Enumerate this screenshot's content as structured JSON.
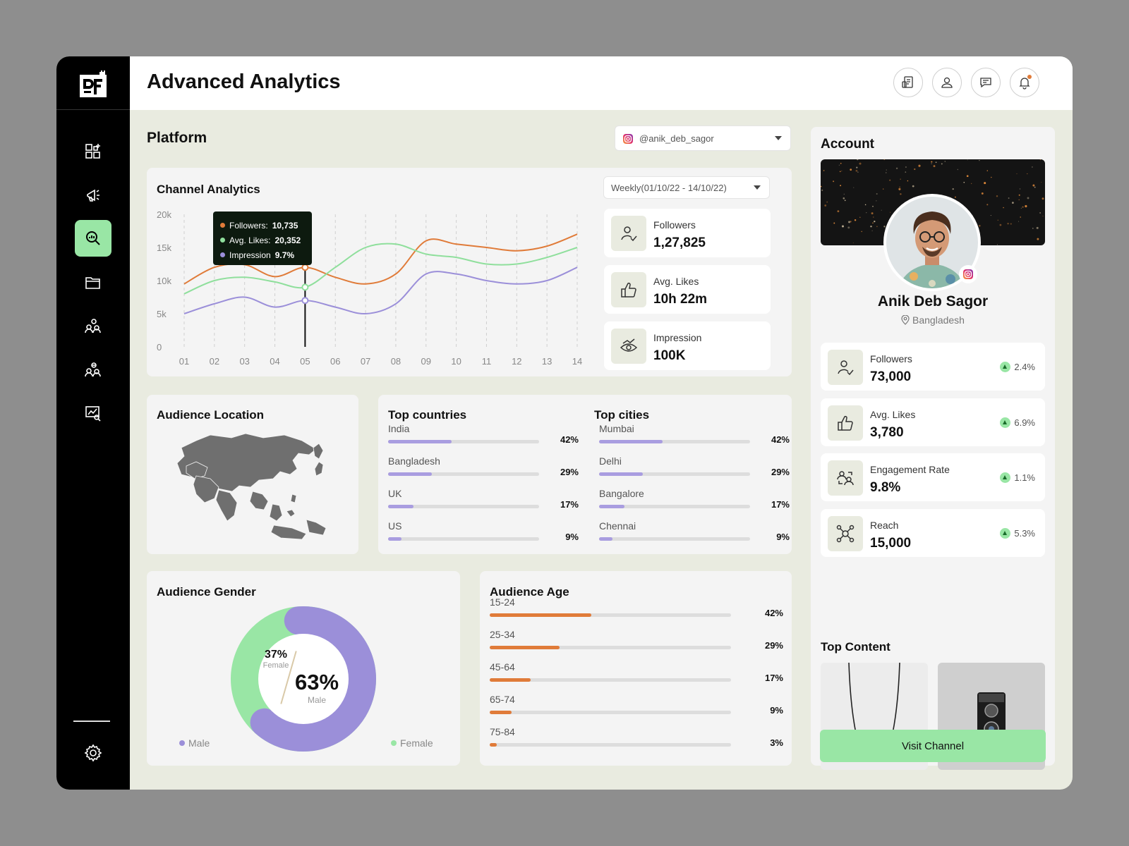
{
  "app": {
    "title": "Advanced Analytics"
  },
  "colors": {
    "green": "#99e6a5",
    "orange": "#e07b39",
    "purple": "#9b8fd9",
    "lavender": "#a99de0"
  },
  "sidebar": {
    "items": [
      {
        "icon": "dashboard-icon"
      },
      {
        "icon": "megaphone-icon"
      },
      {
        "icon": "analytics-search-icon",
        "active": true
      },
      {
        "icon": "folder-icon"
      },
      {
        "icon": "users-icon"
      },
      {
        "icon": "team-icon"
      },
      {
        "icon": "report-icon"
      }
    ],
    "bottom_icon": "settings-icon"
  },
  "header": {
    "icons": [
      "invoice-icon",
      "profile-icon",
      "chat-icon",
      "bell-icon"
    ]
  },
  "platform": {
    "title": "Platform",
    "account_select": "@anik_deb_sagor"
  },
  "channel": {
    "title": "Channel Analytics",
    "range": "Weekly(01/10/22 - 14/10/22)",
    "tooltip": {
      "followers_label": "Followers:",
      "followers_value": "10,735",
      "likes_label": "Avg. Likes:",
      "likes_value": "20,352",
      "impression_label": "Impression",
      "impression_value": "9.7%"
    },
    "stats": [
      {
        "label": "Followers",
        "value": "1,27,825",
        "icon": "user-check-icon"
      },
      {
        "label": "Avg. Likes",
        "value": "10h 22m",
        "icon": "thumbs-up-icon"
      },
      {
        "label": "Impression",
        "value": "100K",
        "icon": "eye-icon"
      }
    ]
  },
  "chart_data": {
    "type": "line",
    "title": "Channel Analytics",
    "x": [
      "01",
      "02",
      "03",
      "04",
      "05",
      "06",
      "07",
      "08",
      "09",
      "10",
      "11",
      "12",
      "13",
      "14"
    ],
    "y_ticks": [
      "20k",
      "15k",
      "10k",
      "5k",
      "0"
    ],
    "ylim": [
      0,
      20000
    ],
    "highlight_x": "05",
    "series": [
      {
        "name": "Followers",
        "color": "#e07b39",
        "values": [
          9500,
          12000,
          12400,
          10600,
          12000,
          10500,
          9500,
          11000,
          16000,
          15500,
          15000,
          14500,
          15200,
          17000
        ]
      },
      {
        "name": "Avg. Likes",
        "color": "#8fdf9c",
        "values": [
          8000,
          10000,
          10500,
          9800,
          9000,
          12000,
          15000,
          15500,
          14000,
          13500,
          12500,
          12500,
          13500,
          15000
        ]
      },
      {
        "name": "Impression",
        "color": "#9b8fd9",
        "values": [
          5000,
          6500,
          7500,
          6000,
          7000,
          6000,
          5000,
          6500,
          11000,
          11000,
          10000,
          9500,
          10000,
          12000
        ]
      }
    ]
  },
  "location": {
    "title": "Audience Location"
  },
  "countries": {
    "title": "Top countries",
    "items": [
      {
        "label": "India",
        "pct": "42%",
        "value": 42
      },
      {
        "label": "Bangladesh",
        "pct": "29%",
        "value": 29
      },
      {
        "label": "UK",
        "pct": "17%",
        "value": 17
      },
      {
        "label": "US",
        "pct": "9%",
        "value": 9
      }
    ]
  },
  "cities": {
    "title": "Top cities",
    "items": [
      {
        "label": "Mumbai",
        "pct": "42%",
        "value": 42
      },
      {
        "label": "Delhi",
        "pct": "29%",
        "value": 29
      },
      {
        "label": "Bangalore",
        "pct": "17%",
        "value": 17
      },
      {
        "label": "Chennai",
        "pct": "9%",
        "value": 9
      }
    ]
  },
  "gender": {
    "title": "Audience Gender",
    "female_pct": "37%",
    "female_label": "Female",
    "male_pct": "63%",
    "male_label": "Male",
    "male_value": 63,
    "female_value": 37,
    "legend_male": "Male",
    "legend_female": "Female"
  },
  "age": {
    "title": "Audience  Age",
    "items": [
      {
        "label": "15-24",
        "pct": "42%",
        "value": 42
      },
      {
        "label": "25-34",
        "pct": "29%",
        "value": 29
      },
      {
        "label": "45-64",
        "pct": "17%",
        "value": 17
      },
      {
        "label": "65-74",
        "pct": "9%",
        "value": 9
      },
      {
        "label": "75-84",
        "pct": "3%",
        "value": 3
      }
    ]
  },
  "account": {
    "title": "Account",
    "name": "Anik Deb Sagor",
    "location": "Bangladesh",
    "stats": [
      {
        "label": "Followers",
        "value": "73,000",
        "change": "2.4%",
        "icon": "user-check-icon"
      },
      {
        "label": "Avg. Likes",
        "value": "3,780",
        "change": "6.9%",
        "icon": "thumbs-up-icon"
      },
      {
        "label": "Engagement Rate",
        "value": "9.8%",
        "change": "1.1%",
        "icon": "engagement-icon"
      },
      {
        "label": "Reach",
        "value": "15,000",
        "change": "5.3%",
        "icon": "network-icon"
      }
    ],
    "top_content_title": "Top Content",
    "visit_button": "Visit Channel"
  }
}
